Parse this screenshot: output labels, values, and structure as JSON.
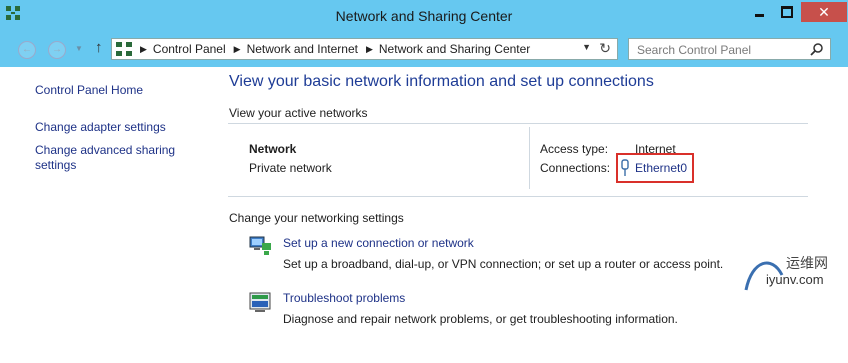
{
  "window": {
    "title": "Network and Sharing Center",
    "colors": {
      "titlebar": "#66c8f0",
      "close": "#c7504b",
      "link": "#1e3287",
      "highlight": "#d9302a"
    }
  },
  "nav": {
    "back_icon": "back-arrow-icon",
    "forward_icon": "forward-arrow-icon",
    "up_icon": "up-arrow-icon"
  },
  "address": {
    "crumbs": [
      "Control Panel",
      "Network and Internet",
      "Network and Sharing Center"
    ]
  },
  "search": {
    "placeholder": "Search Control Panel"
  },
  "sidebar": {
    "items": [
      {
        "label": "Control Panel Home"
      },
      {
        "label": "Change adapter settings"
      },
      {
        "label": "Change advanced sharing settings"
      }
    ]
  },
  "main": {
    "title": "View your basic network information and set up connections",
    "active_heading": "View your active networks",
    "network": {
      "name": "Network",
      "type": "Private network",
      "access_label": "Access type:",
      "access_value": "Internet",
      "connections_label": "Connections:",
      "connection_link": "Ethernet0"
    },
    "change_heading": "Change your networking settings",
    "tasks": [
      {
        "link": "Set up a new connection or network",
        "desc": "Set up a broadband, dial-up, or VPN connection; or set up a router or access point."
      },
      {
        "link": "Troubleshoot problems",
        "desc": "Diagnose and repair network problems, or get troubleshooting information."
      }
    ]
  },
  "watermark": {
    "line1": "运维网",
    "line2": "iyunv.com"
  }
}
